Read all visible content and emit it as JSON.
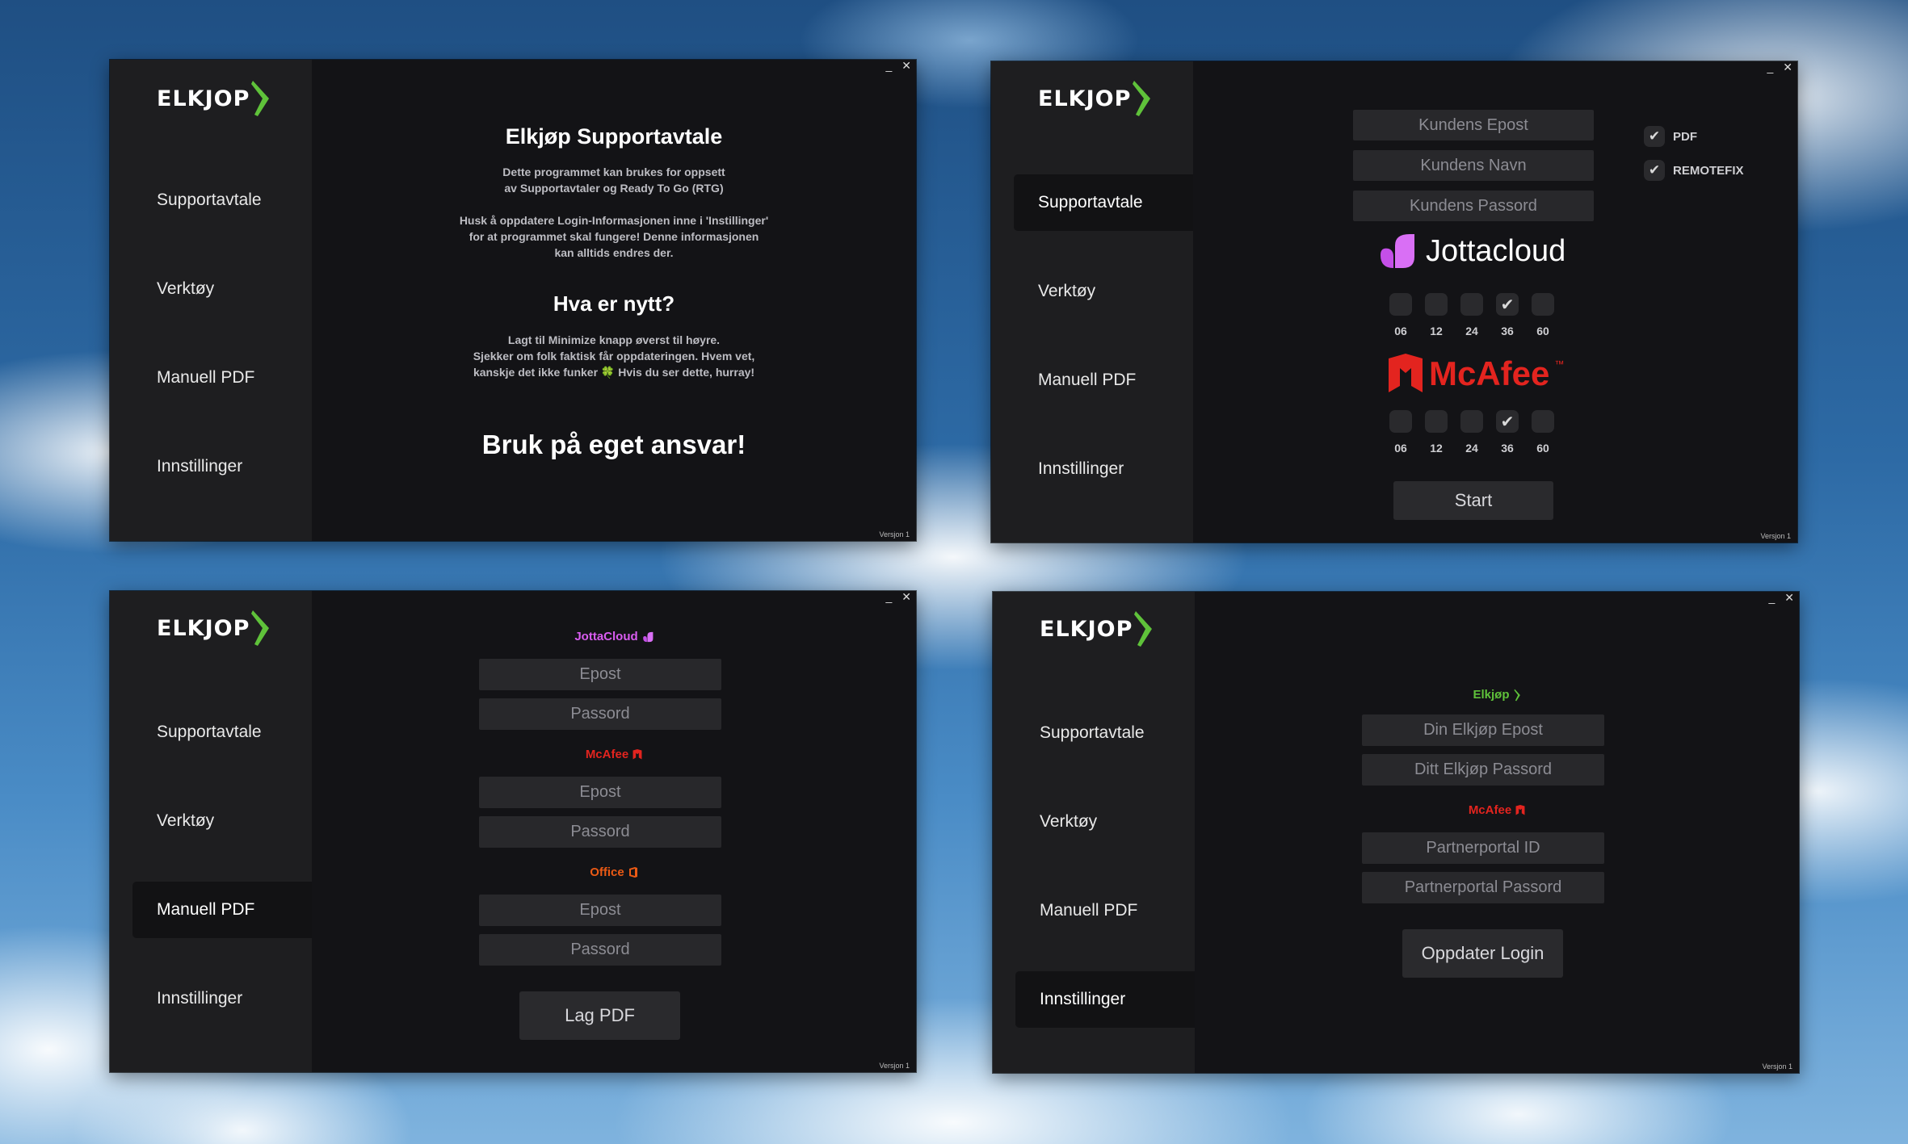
{
  "app": {
    "logo_text": "ELKJOP",
    "version": "Versjon 1",
    "minimize": "_",
    "close": "✕",
    "nav": [
      "Supportavtale",
      "Verktøy",
      "Manuell PDF",
      "Innstillinger"
    ]
  },
  "colors": {
    "accent_green": "#5fc23a",
    "jottacloud": "#d95cf0",
    "mcafee": "#e3241f",
    "office": "#eb5a15"
  },
  "home": {
    "title": "Elkjøp Supportavtale",
    "intro_line1": "Dette programmet kan brukes for oppsett",
    "intro_line2": "av Supportavtaler og Ready To Go (RTG)",
    "note_line1": "Husk å oppdatere Login-Informasjonen inne i 'Instillinger'",
    "note_line2": "for at programmet skal fungere! Denne informasjonen",
    "note_line3": "kan alltids endres der.",
    "news_title": "Hva er nytt?",
    "news_line1": "Lagt til Minimize knapp øverst til høyre.",
    "news_line2": "Sjekker om folk faktisk får oppdateringen. Hvem vet,",
    "news_line3": "kanskje det ikke funker 🍀 Hvis du ser dette, hurray!",
    "warning": "Bruk på eget ansvar!"
  },
  "support": {
    "email_placeholder": "Kundens Epost",
    "name_placeholder": "Kundens Navn",
    "password_placeholder": "Kundens Passord",
    "jottacloud_label": "Jottacloud",
    "mcafee_label": "McAfee",
    "mcafee_tm": "™",
    "months": [
      "06",
      "12",
      "24",
      "36",
      "60"
    ],
    "jotta_checked": [
      false,
      false,
      false,
      true,
      false
    ],
    "mcafee_checked": [
      false,
      false,
      false,
      true,
      false
    ],
    "option_pdf": "PDF",
    "option_remotefix": "REMOTEFIX",
    "start_button": "Start"
  },
  "manual_pdf": {
    "jotta_title": "JottaCloud",
    "mcafee_title": "McAfee",
    "office_title": "Office",
    "email_placeholder": "Epost",
    "password_placeholder": "Passord",
    "create_button": "Lag PDF"
  },
  "settings": {
    "elkjop_title": "Elkjøp",
    "elkjop_email": "Din Elkjøp Epost",
    "elkjop_password": "Ditt Elkjøp Passord",
    "mcafee_title": "McAfee",
    "partner_id": "Partnerportal ID",
    "partner_password": "Partnerportal Passord",
    "update_button": "Oppdater Login"
  }
}
